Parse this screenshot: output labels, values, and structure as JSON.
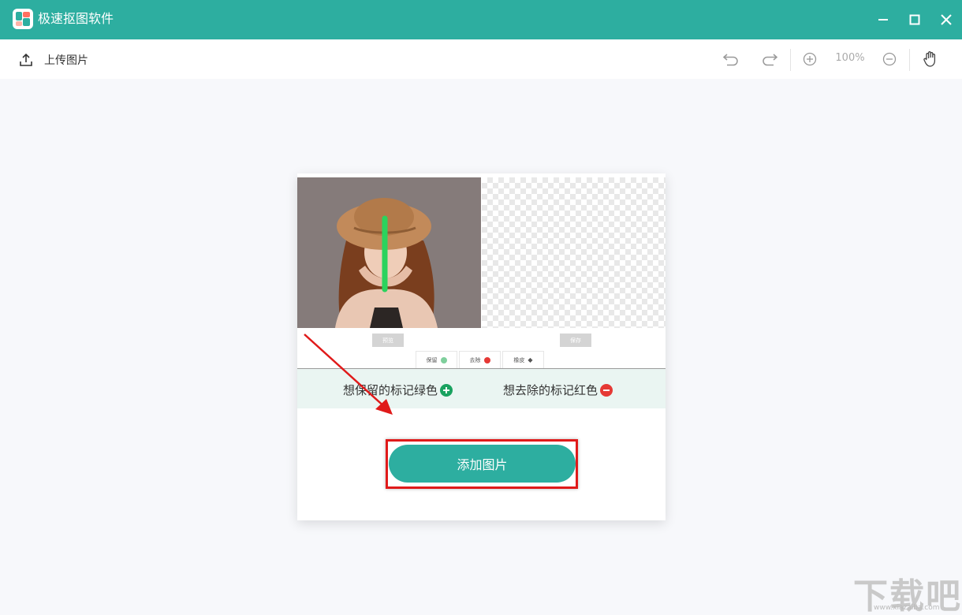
{
  "window": {
    "title": "极速抠图软件",
    "accent": "#2daea0",
    "controls": {
      "minimize": "minimize-icon",
      "maximize": "maximize-icon",
      "close": "close-icon"
    }
  },
  "toolbar": {
    "upload_label": "上传图片",
    "zoom_level": "100%",
    "icons": [
      "upload-icon",
      "undo-icon",
      "redo-icon",
      "zoom-in-icon",
      "zoom-out-icon",
      "hand-icon"
    ]
  },
  "demo": {
    "left_button": "预览",
    "right_button": "保存",
    "tabs": [
      {
        "label": "保留",
        "color": "#2daea0"
      },
      {
        "label": "去除",
        "color": "#e53935"
      },
      {
        "label": "橡皮",
        "color": "#555555"
      }
    ],
    "hint_keep": "想保留的标记绿色",
    "hint_remove": "想去除的标记红色",
    "keep_color": "#1aa260",
    "remove_color": "#e53935"
  },
  "main": {
    "add_image_label": "添加图片"
  },
  "watermark": {
    "text": "下载吧",
    "sub": "www.xiazaiba.com"
  }
}
